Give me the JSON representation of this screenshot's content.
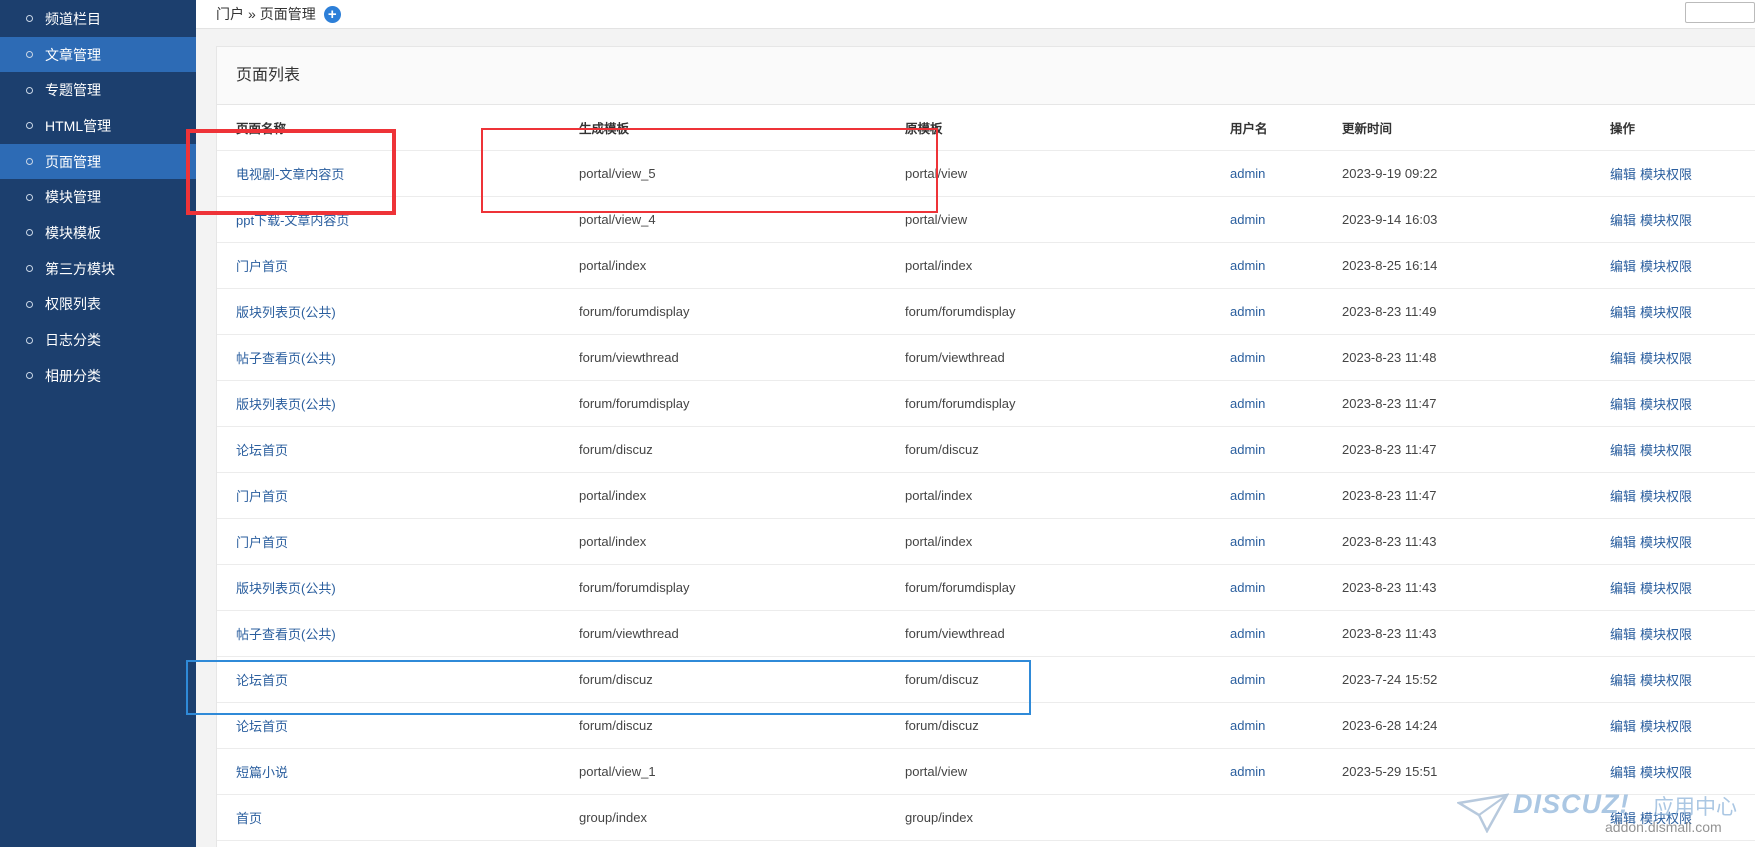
{
  "sidebar": {
    "items": [
      {
        "label": "频道栏目",
        "active": false
      },
      {
        "label": "文章管理",
        "active": true
      },
      {
        "label": "专题管理",
        "active": false
      },
      {
        "label": "HTML管理",
        "active": false
      },
      {
        "label": "页面管理",
        "active": true
      },
      {
        "label": "模块管理",
        "active": false
      },
      {
        "label": "模块模板",
        "active": false
      },
      {
        "label": "第三方模块",
        "active": false
      },
      {
        "label": "权限列表",
        "active": false
      },
      {
        "label": "日志分类",
        "active": false
      },
      {
        "label": "相册分类",
        "active": false
      }
    ]
  },
  "breadcrumb": {
    "root": "门户",
    "separator": "»",
    "current": "页面管理",
    "add_icon": "plus-circle-icon"
  },
  "panel": {
    "title": "页面列表"
  },
  "table": {
    "headers": [
      "页面名称",
      "生成模板",
      "原模板",
      "用户名",
      "更新时间",
      "操作"
    ],
    "rows": [
      {
        "name": "电视剧-文章内容页",
        "target": "portal/view_5",
        "source": "portal/view",
        "user": "admin",
        "time": "2023-9-19 09:22"
      },
      {
        "name": "ppt下载-文章内容页",
        "target": "portal/view_4",
        "source": "portal/view",
        "user": "admin",
        "time": "2023-9-14 16:03"
      },
      {
        "name": "门户首页",
        "target": "portal/index",
        "source": "portal/index",
        "user": "admin",
        "time": "2023-8-25 16:14"
      },
      {
        "name": "版块列表页(公共)",
        "target": "forum/forumdisplay",
        "source": "forum/forumdisplay",
        "user": "admin",
        "time": "2023-8-23 11:49"
      },
      {
        "name": "帖子查看页(公共)",
        "target": "forum/viewthread",
        "source": "forum/viewthread",
        "user": "admin",
        "time": "2023-8-23 11:48"
      },
      {
        "name": "版块列表页(公共)",
        "target": "forum/forumdisplay",
        "source": "forum/forumdisplay",
        "user": "admin",
        "time": "2023-8-23 11:47"
      },
      {
        "name": "论坛首页",
        "target": "forum/discuz",
        "source": "forum/discuz",
        "user": "admin",
        "time": "2023-8-23 11:47"
      },
      {
        "name": "门户首页",
        "target": "portal/index",
        "source": "portal/index",
        "user": "admin",
        "time": "2023-8-23 11:47"
      },
      {
        "name": "门户首页",
        "target": "portal/index",
        "source": "portal/index",
        "user": "admin",
        "time": "2023-8-23 11:43"
      },
      {
        "name": "版块列表页(公共)",
        "target": "forum/forumdisplay",
        "source": "forum/forumdisplay",
        "user": "admin",
        "time": "2023-8-23 11:43"
      },
      {
        "name": "帖子查看页(公共)",
        "target": "forum/viewthread",
        "source": "forum/viewthread",
        "user": "admin",
        "time": "2023-8-23 11:43"
      },
      {
        "name": "论坛首页",
        "target": "forum/discuz",
        "source": "forum/discuz",
        "user": "admin",
        "time": "2023-7-24 15:52"
      },
      {
        "name": "论坛首页",
        "target": "forum/discuz",
        "source": "forum/discuz",
        "user": "admin",
        "time": "2023-6-28 14:24"
      },
      {
        "name": "短篇小说",
        "target": "portal/view_1",
        "source": "portal/view",
        "user": "admin",
        "time": "2023-5-29 15:51"
      },
      {
        "name": "首页",
        "target": "group/index",
        "source": "group/index",
        "user": "",
        "time": ""
      }
    ],
    "actions": {
      "edit": "编辑",
      "perm": "模块权限"
    }
  },
  "watermark": {
    "brand": "DISCUZ!",
    "cn": "应用中心",
    "url": "addon.dismall.com"
  },
  "colors": {
    "sidebar_bg": "#1c3f6e",
    "sidebar_active": "#2d6bb5",
    "link": "#2a5e9e",
    "highlight_red": "#ee3338",
    "highlight_blue": "#2f8ad8"
  }
}
